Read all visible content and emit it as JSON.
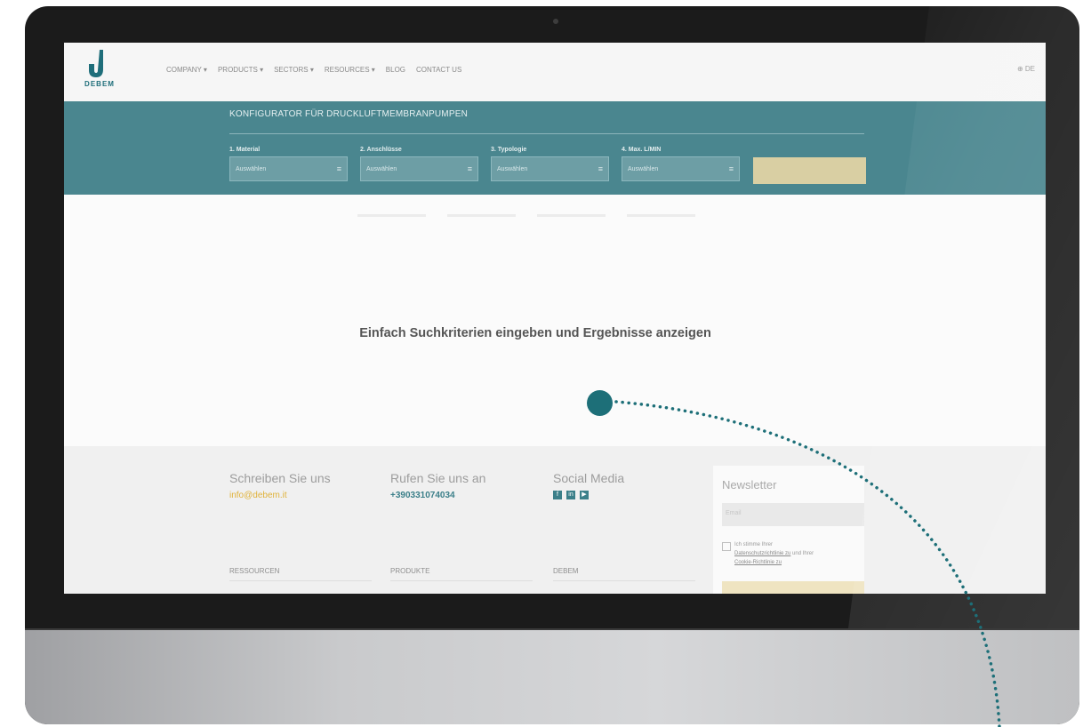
{
  "header": {
    "logo_text": "DEBEM",
    "nav": [
      "COMPANY ▾",
      "PRODUCTS ▾",
      "SECTORS ▾",
      "RESOURCES ▾",
      "BLOG",
      "CONTACT US"
    ],
    "language": "⊕ DE"
  },
  "configurator": {
    "title": "KONFIGURATOR FÜR DRUCKLUFTMEMBRANPUMPEN",
    "fields": [
      {
        "label": "1. Material",
        "value": "Auswählen"
      },
      {
        "label": "2. Anschlüsse",
        "value": "Auswählen"
      },
      {
        "label": "3. Typologie",
        "value": "Auswählen"
      },
      {
        "label": "4. Max. L/MIN",
        "value": "Auswählen"
      }
    ],
    "search_button": ""
  },
  "main": {
    "hint": "Einfach Suchkriterien eingeben und Ergebnisse anzeigen"
  },
  "footer": {
    "write_title": "Schreiben Sie uns",
    "write_email": "info@debem.it",
    "call_title": "Rufen Sie uns an",
    "call_phone": "+390331074034",
    "social_title": "Social Media",
    "social_icons": [
      "f",
      "in",
      "▶"
    ],
    "sections": [
      "RESSOURCEN",
      "PRODUKTE",
      "DEBEM"
    ],
    "newsletter": {
      "title": "Newsletter",
      "email_placeholder": "Email",
      "consent_prefix": "Ich stimme Ihrer",
      "consent_link1": "Datenschutzrichtlinie zu",
      "consent_mid": "und Ihrer",
      "consent_link2": "Cookie-Richtlinie zu"
    }
  },
  "colors": {
    "brand_teal": "#4a868f",
    "accent_yellow": "#e0b23a",
    "annotation": "#1d6f78"
  }
}
